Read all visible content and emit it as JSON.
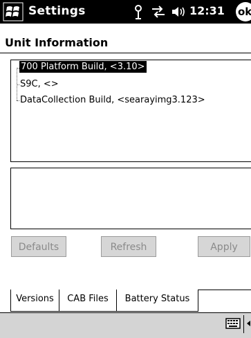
{
  "title_bar": {
    "app_title": "Settings",
    "clock": "12:31",
    "ok_label": "ok"
  },
  "page": {
    "title": "Unit Information"
  },
  "tree": {
    "items": [
      {
        "label": "700 Platform Build, <3.10>",
        "selected": true
      },
      {
        "label": "S9C, <>",
        "selected": false
      },
      {
        "label": "DataCollection Build, <searayimg3.123>",
        "selected": false
      }
    ]
  },
  "buttons": {
    "defaults_label": "Defaults",
    "refresh_label": "Refresh",
    "apply_label": "Apply"
  },
  "tabs": [
    {
      "label": "Versions",
      "active": true
    },
    {
      "label": "CAB Files",
      "active": false
    },
    {
      "label": "Battery Status",
      "active": false
    }
  ],
  "icons": {
    "start": "windows-flag-icon",
    "antenna": "antenna-icon",
    "connectivity": "connectivity-arrows-icon",
    "volume": "speaker-icon",
    "keyboard": "keyboard-icon"
  },
  "colors": {
    "title_bar": "#000000",
    "selection": "#000000",
    "disabled_button": "#d6d6d6",
    "bottom_bar": "#d4d4d4"
  }
}
